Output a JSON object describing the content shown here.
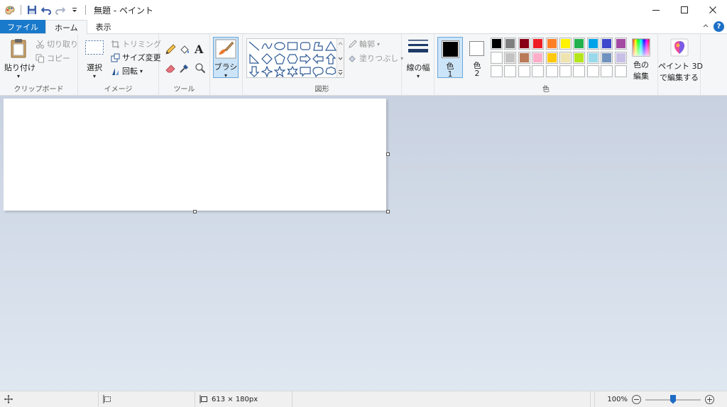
{
  "window": {
    "title": "無題 - ペイント",
    "minimize": "—",
    "maximize": "☐",
    "close": "✕"
  },
  "tabs": [
    {
      "label": "ファイル"
    },
    {
      "label": "ホーム"
    },
    {
      "label": "表示"
    }
  ],
  "ribbon": {
    "clipboard": {
      "paste": "貼り付け",
      "cut": "切り取り",
      "copy": "コピー",
      "group": "クリップボード"
    },
    "image": {
      "select": "選択",
      "crop": "トリミング",
      "resize": "サイズ変更",
      "rotate": "回転",
      "group": "イメージ"
    },
    "tools": {
      "group": "ツール",
      "text_glyph": "A"
    },
    "brushes": {
      "label": "ブラシ"
    },
    "shapes": {
      "outline": "輪郭",
      "fill": "塗りつぶし",
      "group": "図形"
    },
    "size": {
      "label": "線の幅"
    },
    "colors": {
      "color1": "色",
      "color1_num": "1",
      "color2": "色",
      "color2_num": "2",
      "edit": "色の",
      "edit2": "編集",
      "group": "色",
      "color1_value": "#000000",
      "color2_value": "#ffffff",
      "palette_row1": [
        "#000000",
        "#7f7f7f",
        "#880015",
        "#ed1c24",
        "#ff7f27",
        "#fff200",
        "#22b14c",
        "#00a2e8",
        "#3f48cc",
        "#a349a4"
      ],
      "palette_row2": [
        "#ffffff",
        "#c3c3c3",
        "#b97a57",
        "#ffaec9",
        "#ffc90e",
        "#efe4b0",
        "#b5e61d",
        "#99d9ea",
        "#7092be",
        "#c8bfe7"
      ],
      "palette_row3": [
        "#ffffff",
        "#ffffff",
        "#ffffff",
        "#ffffff",
        "#ffffff",
        "#ffffff",
        "#ffffff",
        "#ffffff",
        "#ffffff",
        "#ffffff"
      ]
    },
    "paint3d": {
      "line1": "ペイント 3D",
      "line2": "で編集する"
    }
  },
  "status": {
    "image_size": "613 × 180px",
    "zoom": "100%",
    "zoom_minus": "−",
    "zoom_plus": "+"
  }
}
